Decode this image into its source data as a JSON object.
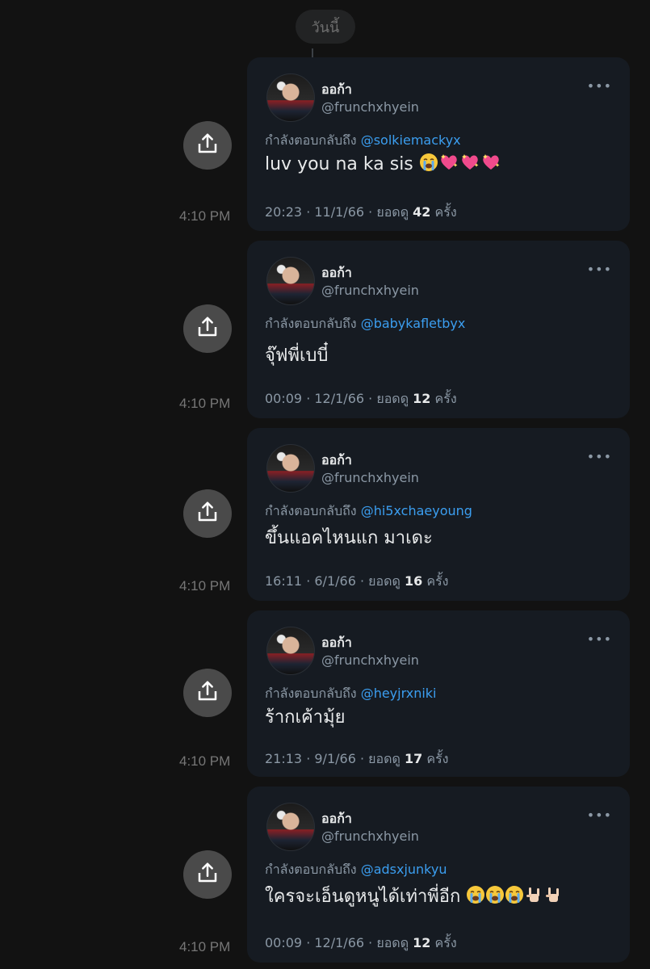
{
  "header": {
    "date_label": "วันนี้"
  },
  "reply_prefix": "กำลังตอบกลับถึง",
  "views_label": "ยอดดู",
  "times_label": "ครั้ง",
  "messages": [
    {
      "time": "4:10 PM",
      "name": "ออก้า",
      "handle": "@frunchxhyein",
      "reply_to": "@solkiemackyx",
      "text": "luv you na ka sis",
      "emojis": [
        "loudly-crying-face",
        "sparkling-heart",
        "sparkling-heart",
        "sparkling-heart"
      ],
      "datetime": "20:23 · 11/1/66 ·",
      "views": "42"
    },
    {
      "time": "4:10 PM",
      "name": "ออก้า",
      "handle": "@frunchxhyein",
      "reply_to": "@babykafletbyx",
      "text": "จุ๊ฟพี่เบบี๋",
      "emojis": [],
      "datetime": "00:09 · 12/1/66 ·",
      "views": "12"
    },
    {
      "time": "4:10 PM",
      "name": "ออก้า",
      "handle": "@frunchxhyein",
      "reply_to": "@hi5xchaeyoung",
      "text": "ขึ้นแอคไหนแก มาเดะ",
      "emojis": [],
      "datetime": "16:11 · 6/1/66 ·",
      "views": "16"
    },
    {
      "time": "4:10 PM",
      "name": "ออก้า",
      "handle": "@frunchxhyein",
      "reply_to": "@heyjrxniki",
      "text": "ร้ากเค้ามุ้ย",
      "emojis": [],
      "datetime": "21:13 · 9/1/66 ·",
      "views": "17"
    },
    {
      "time": "4:10 PM",
      "name": "ออก้า",
      "handle": "@frunchxhyein",
      "reply_to": "@adsxjunkyu",
      "text": "ใครจะเอ็นดูหนูได้เท่าพี่อีก",
      "emojis": [
        "loudly-crying-face",
        "loudly-crying-face",
        "loudly-crying-face",
        "sign-of-the-horns",
        "sign-of-the-horns"
      ],
      "datetime": "00:09 · 12/1/66 ·",
      "views": "12"
    }
  ]
}
